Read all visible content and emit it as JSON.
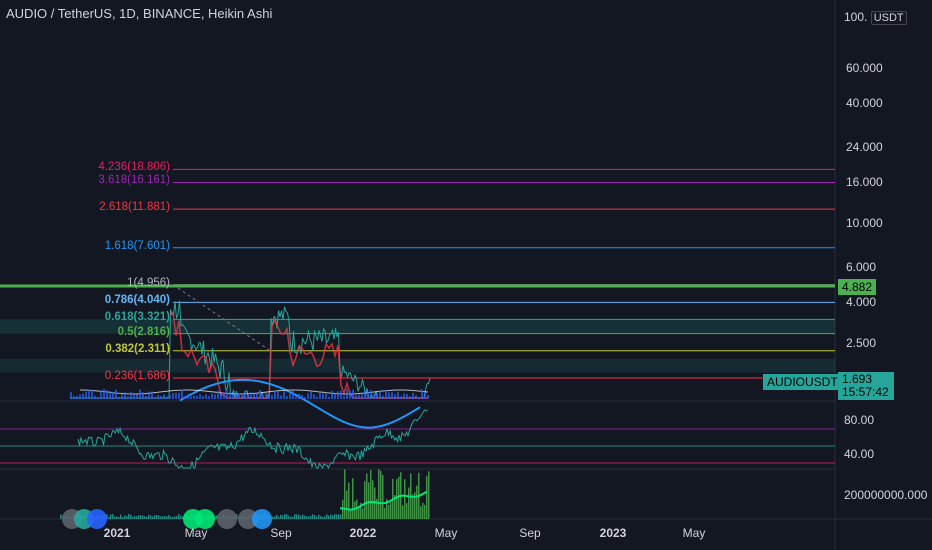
{
  "header": {
    "title": "AUDIO / TetherUS, 1D, BINANCE, Heikin Ashi"
  },
  "price_axis": {
    "unit_label": "USDT",
    "top_label": "100.",
    "ticks": [
      "60.000",
      "40.000",
      "24.000",
      "16.000",
      "10.000",
      "6.000",
      "4.000",
      "2.500"
    ]
  },
  "fib_levels": [
    {
      "label": "4.236(18.806)",
      "color": "#e91e63",
      "value": 18.806
    },
    {
      "label": "3.618(16.161)",
      "color": "#9c27b0",
      "value": 16.161
    },
    {
      "label": "2.618(11.881)",
      "color": "#f23645",
      "value": 11.881
    },
    {
      "label": "1.618(7.601)",
      "color": "#2196f3",
      "value": 7.601
    },
    {
      "label": "1(4.956)",
      "color": "#b2b5be",
      "value": 4.956
    },
    {
      "label": "0.786(4.040)",
      "color": "#64b5f6",
      "value": 4.04
    },
    {
      "label": "0.618(3.321)",
      "color": "#26a69a",
      "value": 3.321
    },
    {
      "label": "0.5(2.816)",
      "color": "#4caf50",
      "value": 2.816
    },
    {
      "label": "0.382(2.311)",
      "color": "#c0ca33",
      "value": 2.311
    },
    {
      "label": "0.236(1.686)",
      "color": "#f23645",
      "value": 1.686
    }
  ],
  "badges": {
    "level_price": "4.882",
    "symbol": "AUDIOUSDT",
    "last_price": "1.693",
    "countdown": "15:57:42"
  },
  "rsi_axis": {
    "ticks": [
      "80.00",
      "40.00"
    ]
  },
  "volume_axis": {
    "ticks": [
      "200000000.000"
    ]
  },
  "time_axis": {
    "labels": [
      "2021",
      "May",
      "Sep",
      "2022",
      "May",
      "Sep",
      "2023",
      "May"
    ]
  },
  "colors": {
    "background": "#131722",
    "green_line": "#4caf50",
    "badge_teal": "#26a69a",
    "rsi_line": "#26a69a"
  }
}
